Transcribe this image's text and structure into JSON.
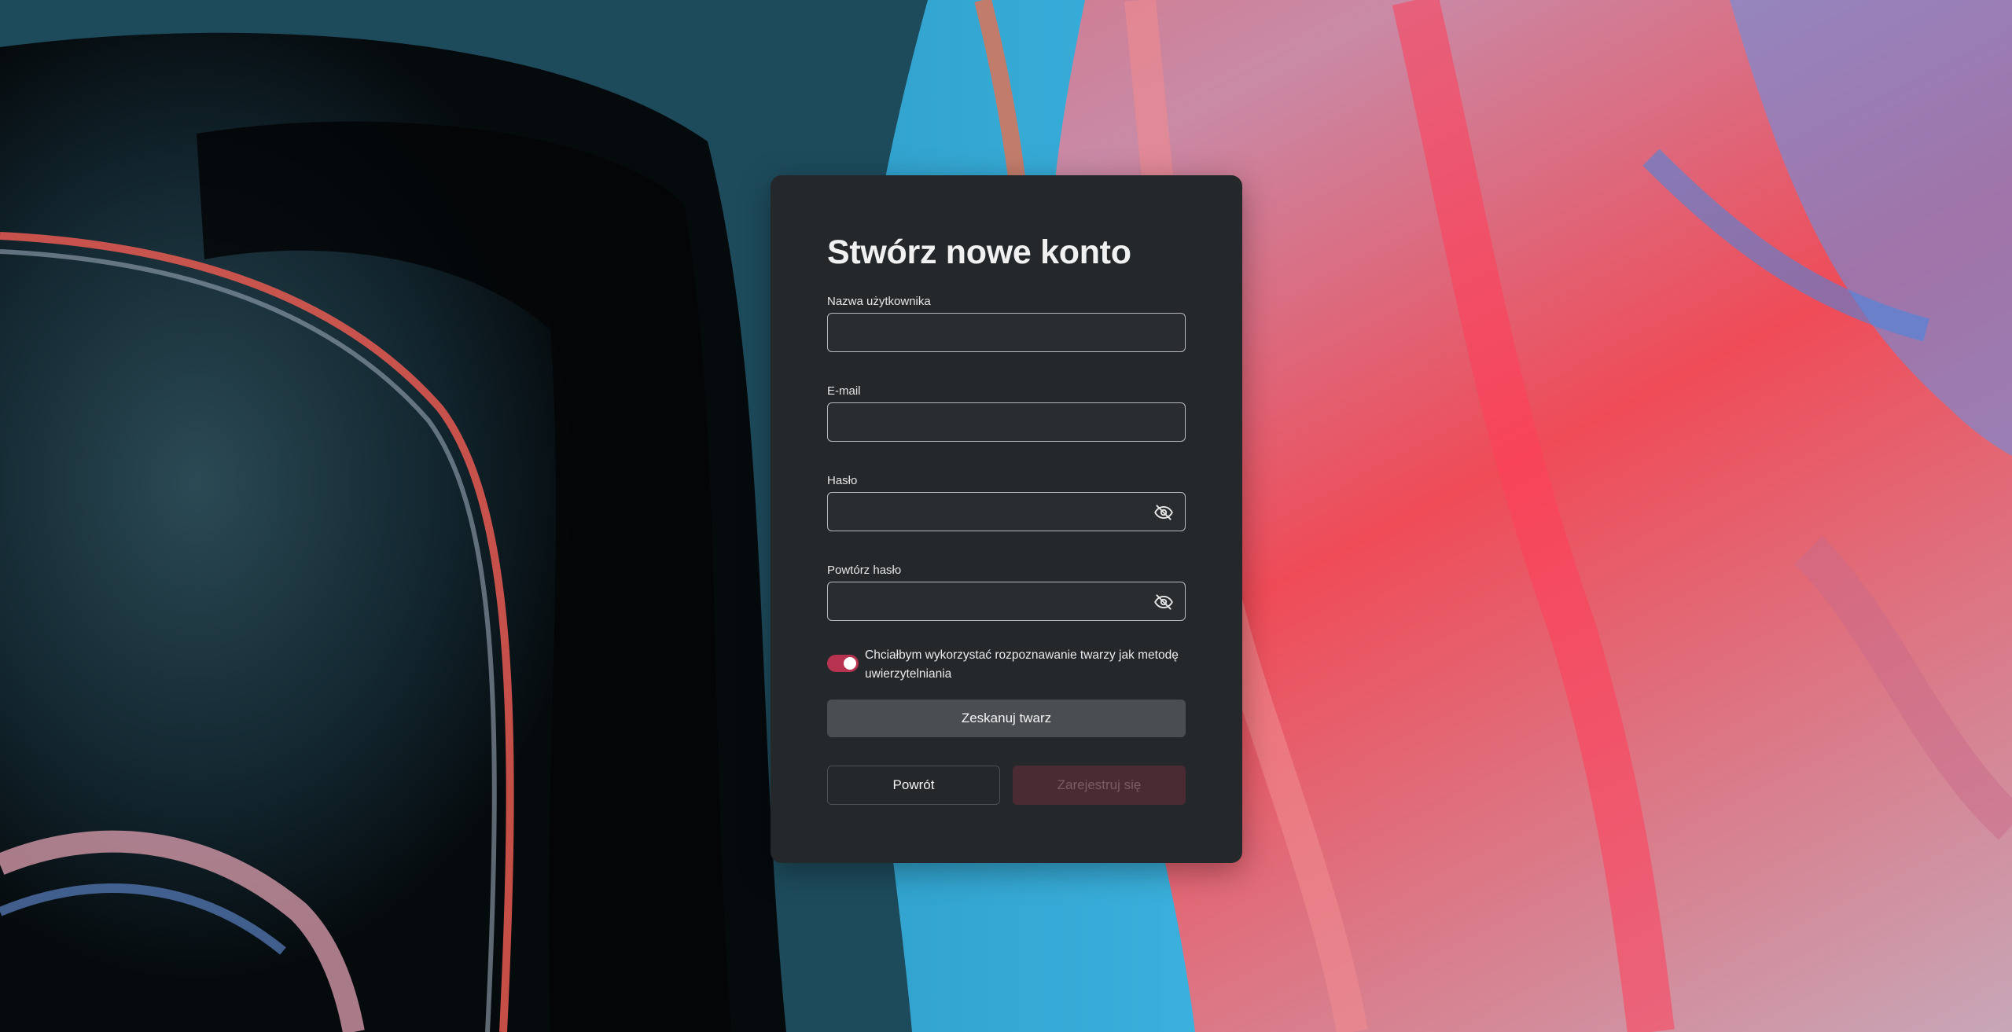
{
  "form": {
    "title": "Stwórz nowe konto",
    "fields": [
      {
        "label": "Nazwa użytkownika",
        "value": "",
        "placeholder": ""
      },
      {
        "label": "E-mail",
        "value": "",
        "placeholder": ""
      },
      {
        "label": "Hasło",
        "value": "",
        "placeholder": "",
        "icon": "eye-off-icon"
      },
      {
        "label": "Powtórz hasło",
        "value": "",
        "placeholder": "",
        "icon": "eye-off-icon"
      }
    ],
    "face_toggle": {
      "label": "Chciałbym wykorzystać rozpoznawanie twarzy jak metodę uwierzytelniania",
      "checked": true,
      "color": "#b8334f"
    },
    "scan_button_label": "Zeskanuj twarz",
    "back_button_label": "Powrót",
    "register_button_label": "Zarejestruj się",
    "register_disabled": true
  },
  "theme": {
    "card_background": "#25282b",
    "accent": "#b8334f"
  }
}
